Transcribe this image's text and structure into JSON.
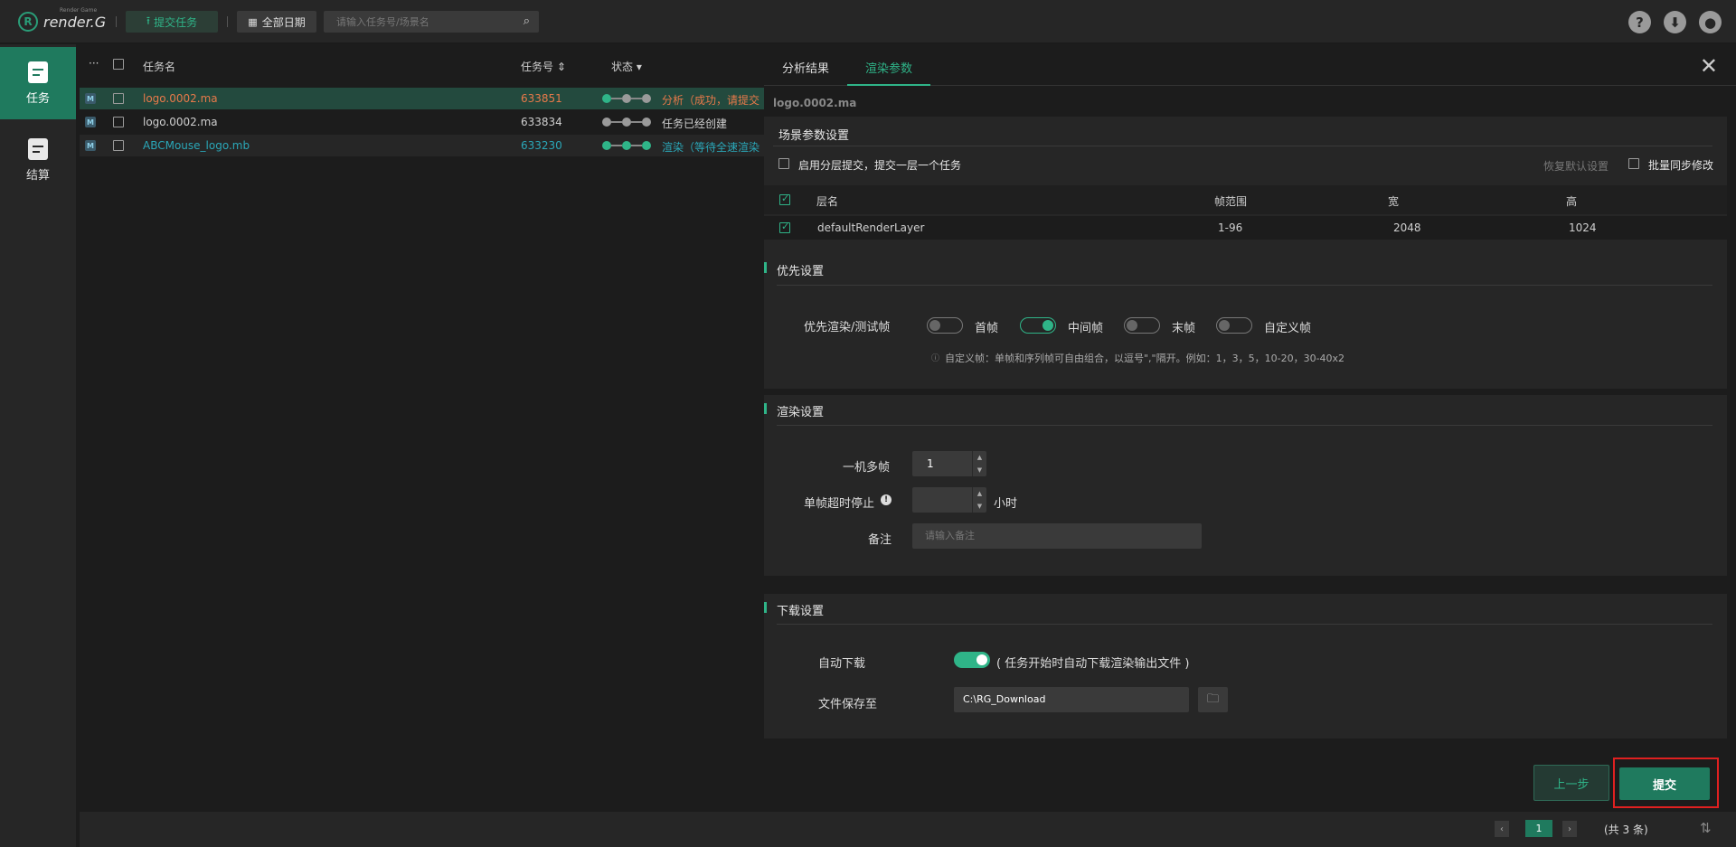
{
  "app": {
    "logo_letter": "R",
    "logo_text": "render.G",
    "logo_sub": "Render Game",
    "submit_task": "提交任务",
    "all_dates": "全部日期",
    "search_placeholder": "请输入任务号/场景名"
  },
  "sidebar": [
    {
      "label": "任务",
      "active": true
    },
    {
      "label": "结算",
      "active": false
    }
  ],
  "table": {
    "headers": {
      "more": "···",
      "name": "任务名",
      "id": "任务号 ⇕",
      "status": "状态 ▾"
    },
    "rows": [
      {
        "badge": "M",
        "name": "logo.0002.ma",
        "id": "633851",
        "status": "分析（成功，请提交",
        "color": "#e8794a"
      },
      {
        "badge": "M",
        "name": "logo.0002.ma",
        "id": "633834",
        "status": "任务已经创建",
        "color": "#cfcfcf"
      },
      {
        "badge": "M",
        "name": "ABCMouse_logo.mb",
        "id": "633230",
        "status": "渲染（等待全速渲染",
        "color": "#2aa7b8"
      }
    ]
  },
  "panel": {
    "tabs": [
      "分析结果",
      "渲染参数"
    ],
    "active_tab": 1,
    "file_title": "logo.0002.ma",
    "scene": {
      "title": "场景参数设置",
      "layered_submit": "启用分层提交，提交一层一个任务",
      "restore_default": "恢复默认设置",
      "batch_modify": "批量同步修改",
      "cols": [
        "层名",
        "帧范围",
        "宽",
        "高"
      ],
      "layer": {
        "name": "defaultRenderLayer",
        "frames": "1-96",
        "width": "2048",
        "height": "1024"
      }
    },
    "priority": {
      "title": "优先设置",
      "label": "优先渲染/测试帧",
      "options": [
        {
          "label": "首帧",
          "on": false
        },
        {
          "label": "中间帧",
          "on": true
        },
        {
          "label": "末帧",
          "on": false
        },
        {
          "label": "自定义帧",
          "on": false
        }
      ],
      "hint": "自定义帧：单帧和序列帧可自由组合，以逗号\",\"隔开。例如：1，3，5，10-20，30-40x2"
    },
    "render": {
      "title": "渲染设置",
      "multi_frame_label": "一机多帧",
      "multi_frame_value": "1",
      "timeout_label": "单帧超时停止",
      "timeout_unit": "小时",
      "note_label": "备注",
      "note_placeholder": "请输入备注"
    },
    "download": {
      "title": "下载设置",
      "auto_label": "自动下载",
      "auto_hint": "( 任务开始时自动下载渲染输出文件 )",
      "save_label": "文件保存至",
      "save_path": "C:\\RG_Download"
    },
    "prev_button": "上一步",
    "submit_button": "提交"
  },
  "pager": {
    "page": "1",
    "total": "(共 3 条)"
  }
}
